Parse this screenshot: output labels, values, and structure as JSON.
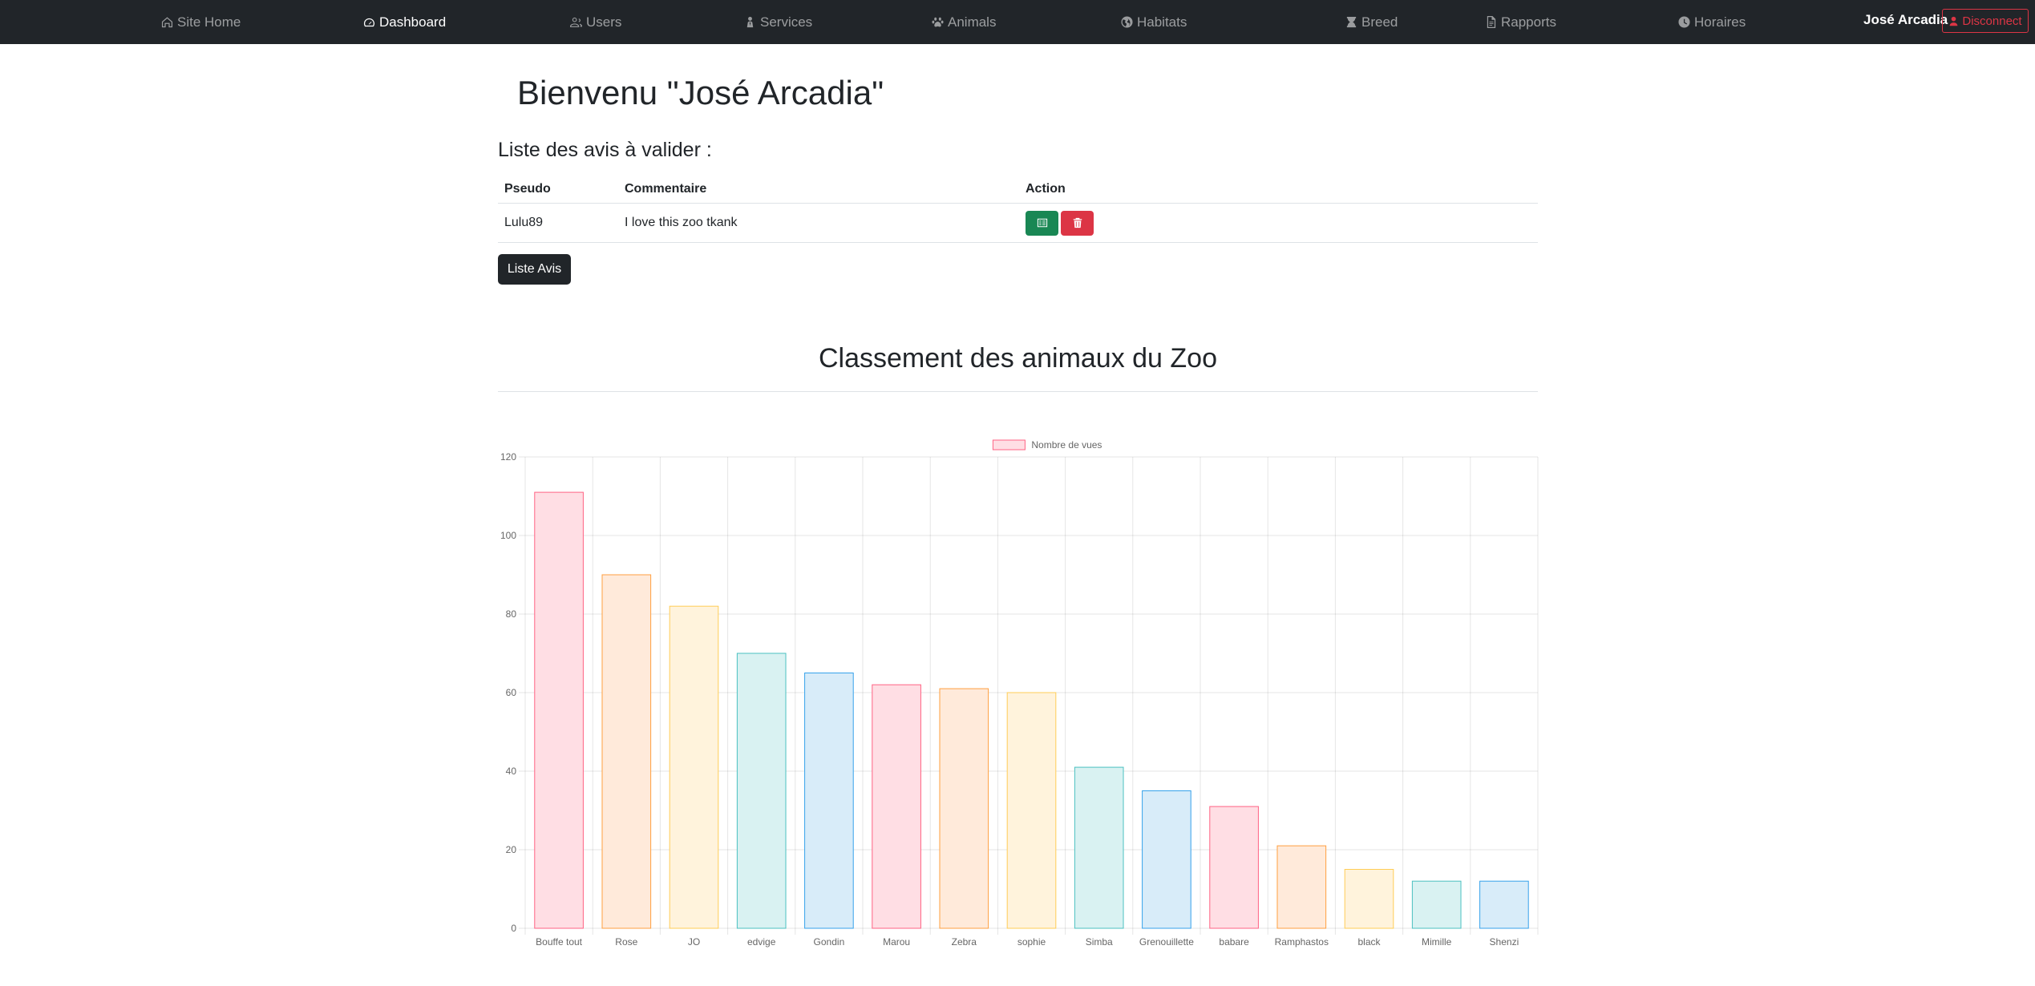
{
  "navbar": {
    "items": [
      {
        "label": "Site Home",
        "icon": "home-icon",
        "active": false
      },
      {
        "label": "Dashboard",
        "icon": "speedometer-icon",
        "active": true
      },
      {
        "label": "Users",
        "icon": "users-icon",
        "active": false
      },
      {
        "label": "Services",
        "icon": "person-service-icon",
        "active": false
      },
      {
        "label": "Animals",
        "icon": "paw-icon",
        "active": false
      },
      {
        "label": "Habitats",
        "icon": "globe-icon",
        "active": false
      },
      {
        "label": "Breed",
        "icon": "hourglass-icon",
        "active": false
      },
      {
        "label": "Rapports",
        "icon": "document-icon",
        "active": false
      },
      {
        "label": "Horaires",
        "icon": "clock-icon",
        "active": false
      }
    ],
    "user_name": "José Arcadia",
    "disconnect_label": "Disconnect"
  },
  "main": {
    "welcome": "Bienvenu \"José Arcadia\"",
    "reviews_title": "Liste des avis à valider :",
    "table": {
      "headers": [
        "Pseudo",
        "Commentaire",
        "Action"
      ],
      "rows": [
        {
          "pseudo": "Lulu89",
          "comment": "I love this zoo tkank"
        }
      ]
    },
    "list_button": "Liste Avis",
    "chart_section_title": "Classement des animaux du Zoo"
  },
  "colors": {
    "navbar_bg": "#212529",
    "success": "#198754",
    "danger": "#dc3545",
    "bar_fills": [
      "#ffdee4",
      "#ffeada",
      "#fff3dc",
      "#d9f2f2",
      "#d8ecf9"
    ],
    "bar_strokes": [
      "#ff6384",
      "#ff9f40",
      "#ffcd56",
      "#4bc0c0",
      "#36a2eb"
    ]
  },
  "chart_data": {
    "type": "bar",
    "legend": "Nombre de vues",
    "legend_position": "top",
    "categories": [
      "Bouffe tout",
      "Rose",
      "JO",
      "edvige",
      "Gondin",
      "Marou",
      "Zebra",
      "sophie",
      "Simba",
      "Grenouillette",
      "babare",
      "Ramphastos",
      "black",
      "Mimille",
      "Shenzi"
    ],
    "series": [
      {
        "name": "Nombre de vues",
        "values": [
          111,
          90,
          82,
          70,
          65,
          62,
          61,
          60,
          41,
          35,
          31,
          21,
          15,
          12,
          12
        ]
      }
    ],
    "ylim": [
      0,
      120
    ],
    "yticks": [
      0,
      20,
      40,
      60,
      80,
      100,
      120
    ],
    "grid": true
  }
}
